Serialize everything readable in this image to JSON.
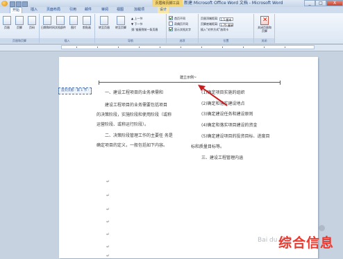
{
  "window": {
    "context_tab": "页眉和页脚工具",
    "title": "新建 Microsoft Office Word 文档 - Microsoft Word",
    "buttons": [
      "_",
      "□",
      "X"
    ]
  },
  "tabs": [
    {
      "label": "开始"
    },
    {
      "label": "插入"
    },
    {
      "label": "页面布局"
    },
    {
      "label": "引用"
    },
    {
      "label": "邮件"
    },
    {
      "label": "审阅"
    },
    {
      "label": "视图"
    },
    {
      "label": "加载项"
    },
    {
      "label": "设计"
    }
  ],
  "ribbon": {
    "groups": {
      "header_footer": {
        "label": "页眉和页脚",
        "buttons": [
          "页眉",
          "页脚",
          "页码"
        ]
      },
      "insert": {
        "label": "插入",
        "buttons": [
          "日期和时间",
          "文档部件",
          "图片",
          "剪贴画"
        ]
      },
      "navigation": {
        "label": "导航",
        "goto_button": "转至页眉",
        "goto_footer": "转至页脚",
        "prev": "上一节",
        "next": "下一节",
        "link": "链接到前一条页眉"
      },
      "options": {
        "label": "选项",
        "items": [
          {
            "label": "首页不同",
            "checked": true
          },
          {
            "label": "奇偶页不同",
            "checked": false
          },
          {
            "label": "显示文档文字",
            "checked": true
          }
        ]
      },
      "position": {
        "label": "位置",
        "rows": [
          {
            "label": "页眉顶端距离:",
            "value": "1.5 厘米"
          },
          {
            "label": "页脚底端距离:",
            "value": "1.75 厘米"
          },
          {
            "label": "插入“对齐方式”选项卡",
            "value": ""
          }
        ]
      },
      "close": {
        "label": "关闭",
        "button": "关闭页眉和页脚"
      }
    }
  },
  "document": {
    "header_text": "建立示例~",
    "header_tag": "首页页眉 - 第 1 节 -",
    "left_column": [
      "一、建设工程项目的业务承需和",
      "建设工程项目的业务需要包括项目",
      "的决策阶段，实施阶段和使用阶段（或称",
      "运营阶段、或称运行阶段）。",
      "二、决策阶段管理工作的主要任 务是",
      "确定项目的定义，一般包括如下内容。"
    ],
    "right_column": [
      "(1)确定项目实施的组织",
      "(2)确定和落实建设地点",
      "(3)确定建设任务和建设原则",
      "(4)确定和落实项目建设的资金",
      "(5)确定建设项目的投资目标、进度目",
      "标和质量目标等。",
      "三、建设工程管理内涵"
    ],
    "para_marks": [
      "↵",
      "↵",
      "↵",
      "↵",
      "↵",
      "↵",
      "↵"
    ]
  },
  "overlay": {
    "watermark": "Bai du 经验",
    "brand": "综合信息"
  },
  "colors": {
    "accent_arrow": "#c81e1e",
    "brand_red": "#e83a30",
    "ribbon_blue": "#15428b"
  }
}
